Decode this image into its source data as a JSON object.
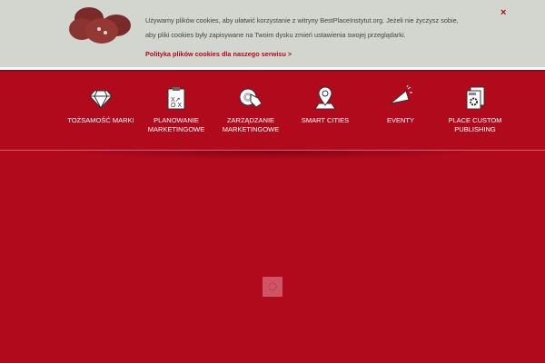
{
  "cookie_banner": {
    "line1": "Używamy plików cookies, aby ułatwić korzystanie z witryny BestPlaceInstytut.org. Jeżeli nie życzysz sobie,",
    "line2": "aby pliki cookies były zapisywane na Twoim dysku zmień ustawienia swojej przeglądarki.",
    "policy_link": "Polityka plików cookies dla naszego serwisu >",
    "close": "×"
  },
  "nav": [
    {
      "label": "Tożsamość marki",
      "icon": "diamond-icon"
    },
    {
      "label": "Planowanie marketingowe",
      "icon": "clipboard-plan-icon"
    },
    {
      "label": "Zarządzanie marketingowe",
      "icon": "target-hand-icon"
    },
    {
      "label": "Smart cities",
      "icon": "map-pin-icon"
    },
    {
      "label": "Eventy",
      "icon": "megaphone-icon"
    },
    {
      "label": "Place custom publishing",
      "icon": "document-gear-icon"
    }
  ]
}
